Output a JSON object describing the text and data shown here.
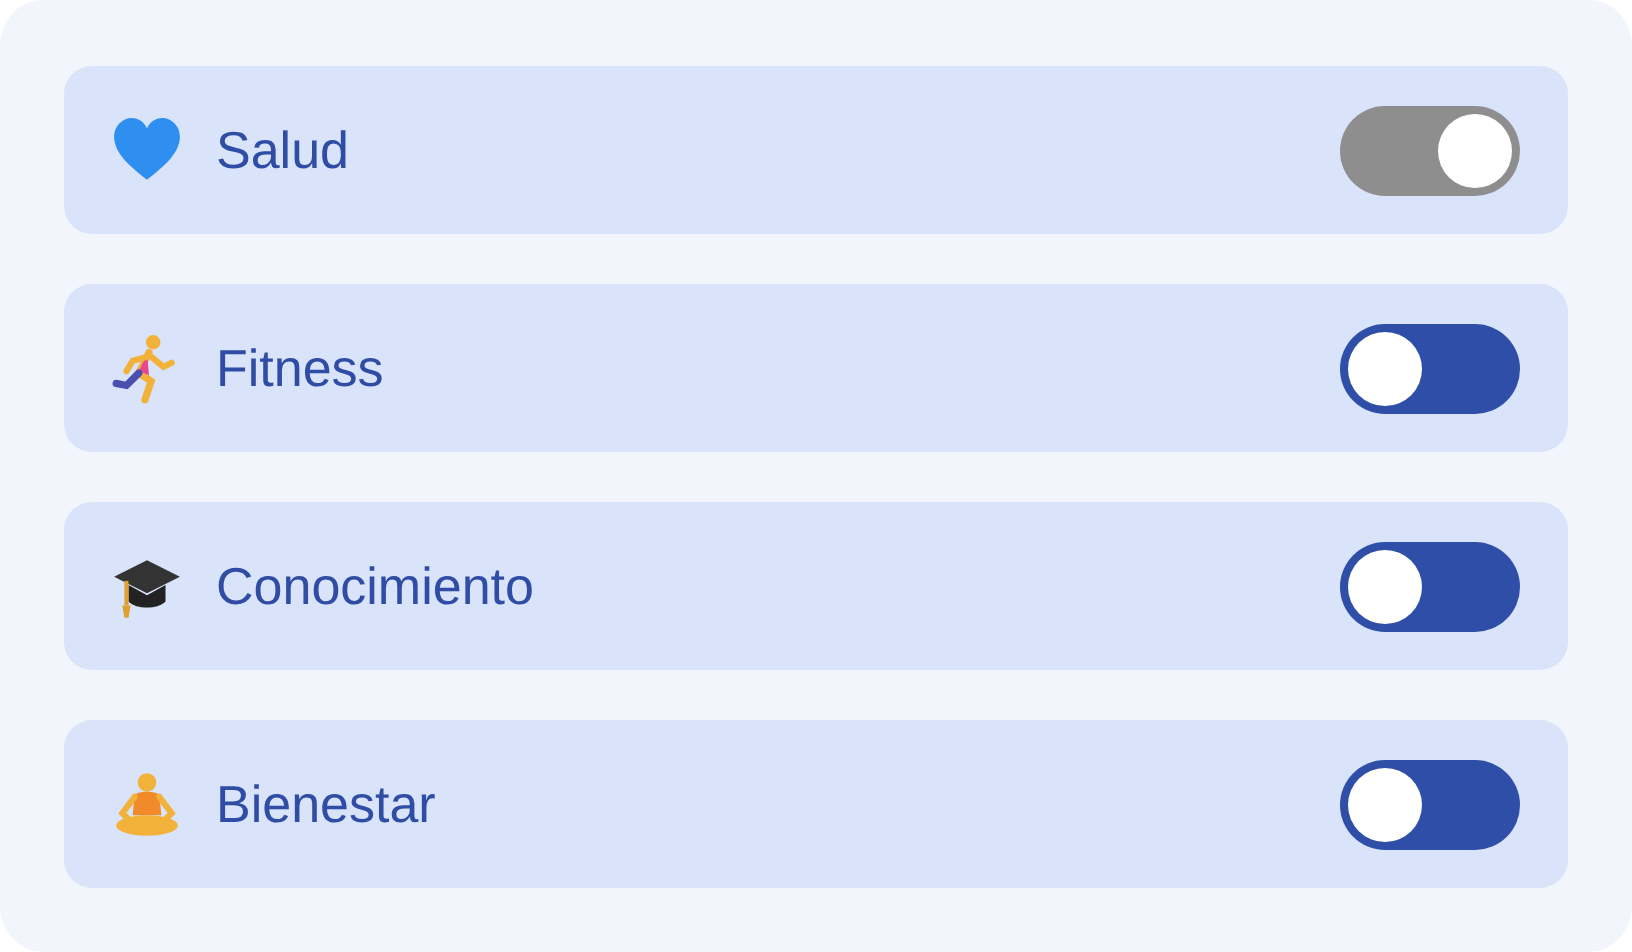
{
  "categories": [
    {
      "label": "Salud",
      "kind": "heart",
      "on": true
    },
    {
      "label": "Fitness",
      "kind": "runner",
      "on": false
    },
    {
      "label": "Conocimiento",
      "kind": "cap",
      "on": false
    },
    {
      "label": "Bienestar",
      "kind": "meditation",
      "on": false
    }
  ]
}
